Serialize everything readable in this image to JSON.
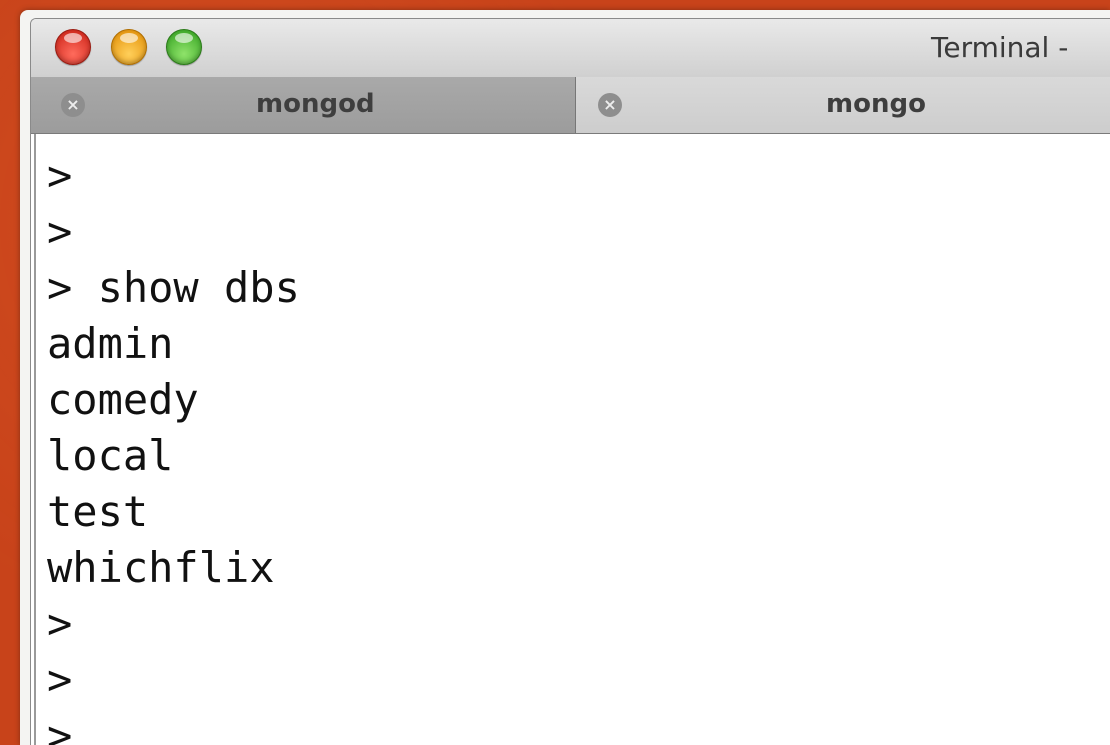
{
  "window": {
    "title": "Terminal -",
    "traffic_lights": [
      "close",
      "minimize",
      "zoom"
    ]
  },
  "tabs": [
    {
      "label": "mongod",
      "close_icon": "x-circle-icon",
      "active": false
    },
    {
      "label": "mongo",
      "close_icon": "x-circle-icon",
      "active": true
    }
  ],
  "terminal": {
    "lines": [
      ">",
      ">",
      "> show dbs",
      "admin",
      "comedy",
      "local",
      "test",
      "whichflix",
      ">",
      ">",
      ">"
    ]
  }
}
